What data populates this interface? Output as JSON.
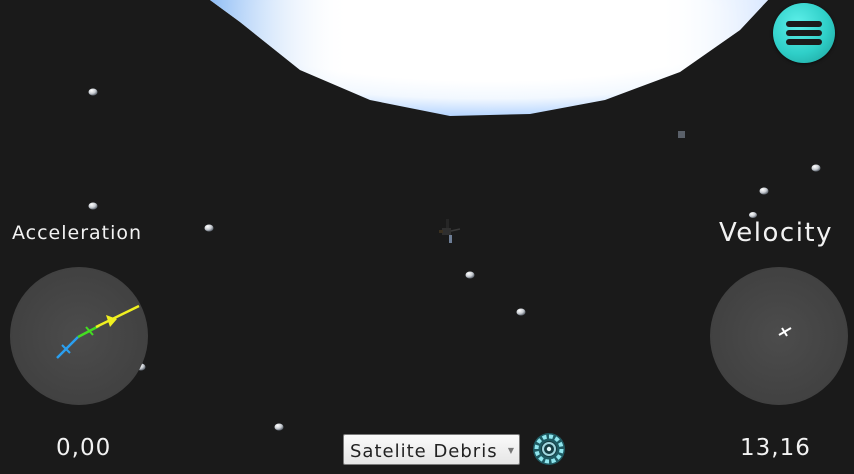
{
  "hud": {
    "acceleration_label": "Acceleration",
    "acceleration_value": "0,00",
    "velocity_label": "Velocity",
    "velocity_value": "13,16"
  },
  "target_selector": {
    "selected": "Satelite Debris"
  },
  "icons": {
    "menu": "hamburger-menu-icon",
    "target_lock": "target-lock-icon",
    "spacecraft": "spacecraft-icon"
  },
  "colors": {
    "space": "#1a1a1a",
    "planet": "#ffffff",
    "menu_button": "#2fcfc8",
    "vector_prograde": "#f0f020",
    "vector_normal": "#44dd22",
    "vector_radial": "#2a9ff0"
  }
}
